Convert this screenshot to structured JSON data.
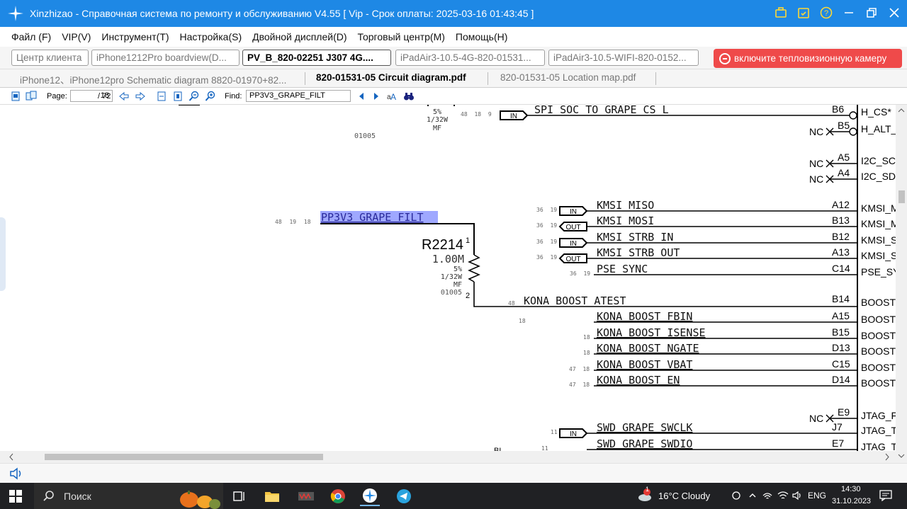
{
  "window": {
    "title": "Xinzhizao - Справочная система по ремонту и обслуживанию V4.55 [ Vip - Срок оплаты: 2025-03-16 01:43:45 ]"
  },
  "menu": [
    "Файл (F)",
    "VIP(V)",
    "Инструмент(T)",
    "Настройка(S)",
    "Двойной дисплей(D)",
    "Торговый центр(M)",
    "Помощь(H)"
  ],
  "tabs_row1": [
    {
      "label": "Центр клиента",
      "active": false
    },
    {
      "label": "iPhone1212Pro boardview(D...",
      "active": false
    },
    {
      "label": "PV_B_820-02251 J307 4G....",
      "active": true
    },
    {
      "label": "iPadAir3-10.5-4G-820-01531...",
      "active": false
    },
    {
      "label": "iPadAir3-10.5-WIFI-820-0152...",
      "active": false
    }
  ],
  "camera_button": "включите тепловизионную камеру",
  "tabs_row2": [
    {
      "label": "iPhone12、iPhone12pro Schematic diagram 8820-01970+82...",
      "active": false
    },
    {
      "label": "820-01531-05 Circuit diagram.pdf",
      "active": true
    },
    {
      "label": "820-01531-05 Location map.pdf",
      "active": false
    }
  ],
  "toolbar": {
    "page_label": "Page:",
    "page_value": "18",
    "page_total": "/ 72",
    "find_label": "Find:",
    "find_value": "PP3V3_GRAPE_FILT"
  },
  "schematic": {
    "top_resistor": {
      "tolerance": "5%",
      "power": "1/32W",
      "type": "MF",
      "code": "01005"
    },
    "resistor": {
      "ref": "R2214",
      "value": "1.00M",
      "tolerance": "5%",
      "power": "1/32W",
      "type": "MF",
      "code": "01005",
      "pin1": "1",
      "pin2": "2"
    },
    "highlight_net": {
      "name": "PP3V3_GRAPE_FILT",
      "pages": "48 19 18"
    },
    "kona_atest": {
      "name": "KONA_BOOST_ATEST",
      "pages": "48",
      "extra": "18",
      "pin": "B14",
      "right": "BOOST"
    },
    "bl_text": "BL",
    "nets": [
      {
        "name": "SPI_SOC_TO_GRAPE_CS_L",
        "pages": "48 18 9",
        "flag": "IN",
        "pin": "B6",
        "right": "H_CS*"
      },
      {
        "name": "KMSI_MISO",
        "pages": "36 19",
        "flag": "IN",
        "pin": "A12",
        "right": "KMSI_M"
      },
      {
        "name": "KMSI_MOSI",
        "pages": "36 19",
        "flag": "OUT",
        "pin": "B13",
        "right": "KMSI_M"
      },
      {
        "name": "KMSI_STRB_IN",
        "pages": "36 19",
        "flag": "IN",
        "pin": "B12",
        "right": "KMSI_S"
      },
      {
        "name": "KMSI_STRB_OUT",
        "pages": "36 19",
        "flag": "OUT",
        "pin": "A13",
        "right": "KMSI_S"
      },
      {
        "name": "PSE_SYNC",
        "pages": "36 19",
        "flag": "",
        "pin": "C14",
        "right": "PSE_SY"
      },
      {
        "name": "KONA_BOOST_FBIN",
        "pages": "",
        "flag": "",
        "pin": "A15",
        "right": "BOOST"
      },
      {
        "name": "KONA_BOOST_ISENSE",
        "pages": "18",
        "flag": "",
        "pin": "B15",
        "right": "BOOST"
      },
      {
        "name": "KONA_BOOST_NGATE",
        "pages": "18",
        "flag": "",
        "pin": "D13",
        "right": "BOOST"
      },
      {
        "name": "KONA_BOOST_VBAT",
        "pages": "47 18",
        "flag": "",
        "pin": "C15",
        "right": "BOOST"
      },
      {
        "name": "KONA_BOOST_EN",
        "pages": "47 18",
        "flag": "",
        "pin": "D14",
        "right": "BOOST"
      },
      {
        "name": "SWD_GRAPE_SWCLK",
        "pages": "11",
        "flag": "IN",
        "pin": "J7",
        "right": "JTAG_T"
      },
      {
        "name": "SWD_GRAPE_SWDIO",
        "pages": "11",
        "flag": "",
        "pin": "E7",
        "right": "JTAG_T"
      }
    ],
    "nc_pins": [
      {
        "nc": "NC",
        "pin": "B5",
        "right": "H_ALT_"
      },
      {
        "nc": "NC",
        "pin": "A5",
        "right": "I2C_SC"
      },
      {
        "nc": "NC",
        "pin": "A4",
        "right": "I2C_SD"
      },
      {
        "nc": "NC",
        "pin": "E9",
        "right": "JTAG_F"
      }
    ]
  },
  "taskbar": {
    "search": "Поиск",
    "weather": "16°C  Cloudy",
    "weather_badge": "1",
    "lang": "ENG",
    "time": "14:30",
    "date": "31.10.2023"
  }
}
